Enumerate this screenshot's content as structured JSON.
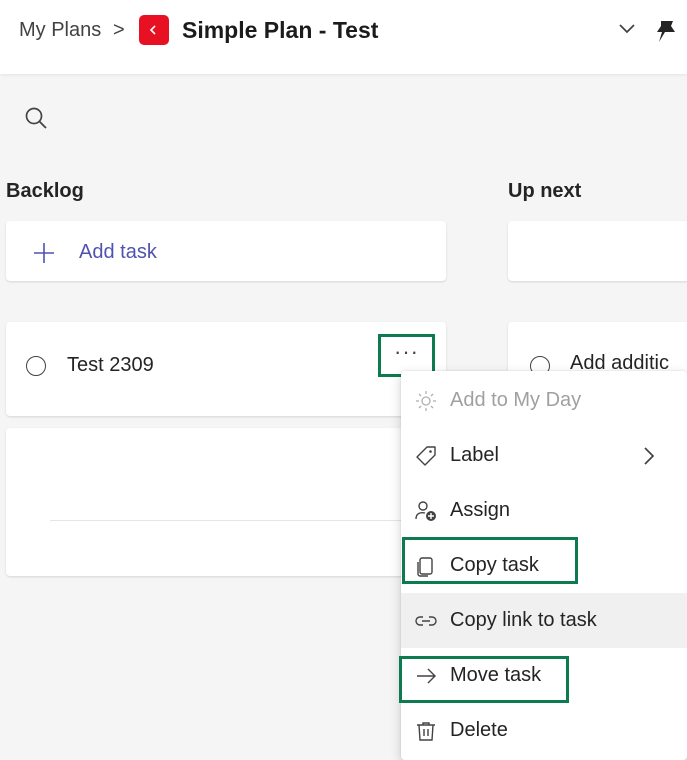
{
  "header": {
    "breadcrumb": "My Plans",
    "breadcrumb_separator": ">",
    "plan_title": "Simple Plan - Test",
    "plan_icon_color": "#e81123"
  },
  "search": {
    "icon": "search-icon"
  },
  "columns": [
    {
      "title": "Backlog",
      "add_task_label": "Add task"
    },
    {
      "title": "Up next",
      "task_title_partial": "Add additic"
    }
  ],
  "tasks": [
    {
      "title": "Test 2309"
    }
  ],
  "context_menu": {
    "items": [
      {
        "label": "Add to My Day",
        "icon": "sun-icon",
        "disabled": true
      },
      {
        "label": "Label",
        "icon": "tag-icon",
        "has_submenu": true
      },
      {
        "label": "Assign",
        "icon": "person-add-icon"
      },
      {
        "label": "Copy task",
        "icon": "copy-icon",
        "highlighted": true
      },
      {
        "label": "Copy link to task",
        "icon": "link-icon",
        "hovered": true
      },
      {
        "label": "Move task",
        "icon": "arrow-right-icon",
        "highlighted": true
      },
      {
        "label": "Delete",
        "icon": "trash-icon"
      }
    ]
  },
  "colors": {
    "accent": "#4f52b2",
    "highlight_box": "#0e7a4f"
  }
}
